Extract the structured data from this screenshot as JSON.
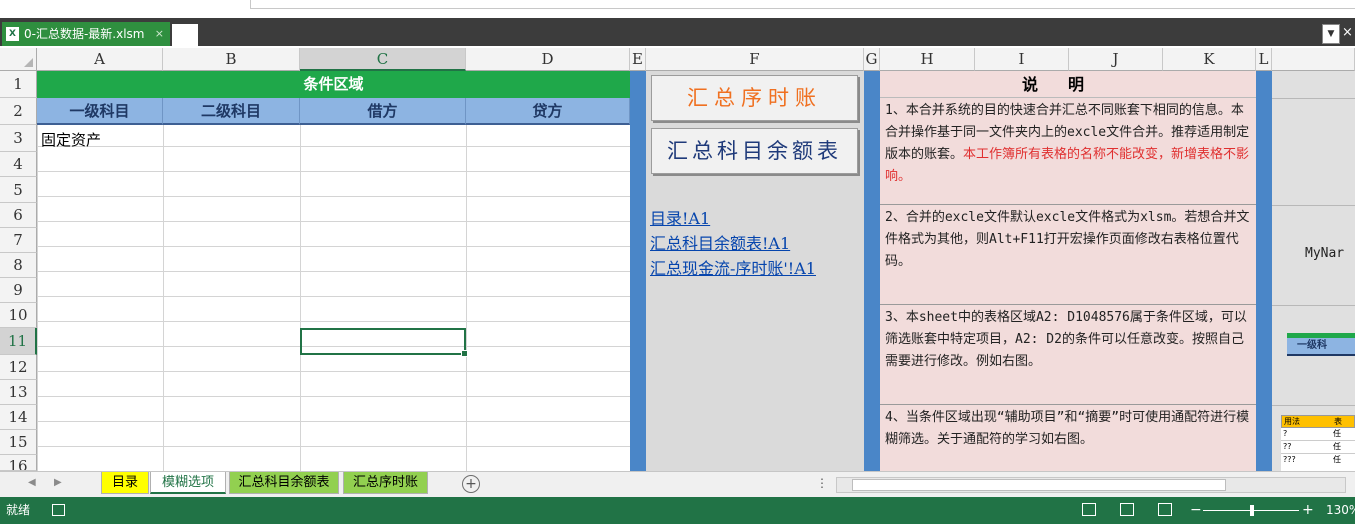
{
  "document": {
    "filename": "0-汇总数据-最新.xlsm"
  },
  "columns": [
    "A",
    "B",
    "C",
    "D",
    "E",
    "F",
    "G",
    "H",
    "I",
    "J",
    "K",
    "L"
  ],
  "rows": [
    "1",
    "2",
    "3",
    "4",
    "5",
    "6",
    "7",
    "8",
    "9",
    "10",
    "11",
    "12",
    "13",
    "14",
    "15",
    "16"
  ],
  "selected": {
    "column": "C",
    "row": "11"
  },
  "sheet": {
    "title": "条件区域",
    "headers": [
      "一级科目",
      "二级科目",
      "借方",
      "贷方"
    ],
    "a3": "固定资产"
  },
  "buttons": {
    "ledger": "汇总序时账",
    "balance": "汇总科目余额表"
  },
  "links": [
    "目录!A1",
    "汇总科目余额表!A1",
    "汇总现金流-序时账'!A1"
  ],
  "notes": {
    "title": "说明",
    "n1": "1、本合并系统的目的快速合并汇总不同账套下相同的信息。本合并操作基于同一文件夹内上的excle文件合并。推荐适用制定版本的账套。",
    "n1_red": "本工作簿所有表格的名称不能改变，新增表格不影响。",
    "n2": "2、合并的excle文件默认excle文件格式为xlsm。若想合并文件格式为其他，则Alt+F11打开宏操作页面修改右表格位置代码。",
    "n3": "3、本sheet中的表格区域A2: D1048576属于条件区域，可以筛选账套中特定项目，A2: D2的条件可以任意改变。按照自己需要进行修改。例如右图。",
    "n4": "4、当条件区域出现“辅助项目”和“摘要”时可使用通配符进行模糊筛选。关于通配符的学习如右图。"
  },
  "right": {
    "myname": "MyNar",
    "mini_header": "一级科",
    "mini_table": {
      "col1": "用法",
      "col2": "表",
      "rows": [
        [
          "?",
          "任"
        ],
        [
          "??",
          "任"
        ],
        [
          "???",
          "任"
        ]
      ]
    }
  },
  "tabs": [
    {
      "label": "目录",
      "bg": "#ffff00"
    },
    {
      "label": "模糊选项",
      "bg": "#ffffff"
    },
    {
      "label": "汇总科目余额表",
      "bg": "#92d050"
    },
    {
      "label": "汇总序时账",
      "bg": "#92d050"
    }
  ],
  "status": {
    "ready": "就绪",
    "zoom": "130%"
  },
  "colors": {
    "excel_green": "#217346",
    "title_green": "#1fa84a",
    "header_blue": "#8db4e2",
    "note_pink": "#f2dcdb",
    "orange": "#f07020",
    "navy": "#1f3a7a"
  }
}
